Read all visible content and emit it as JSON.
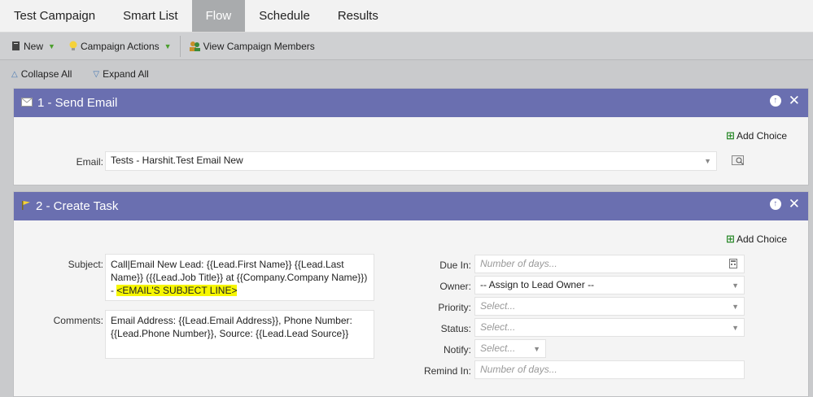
{
  "tabs": [
    "Test Campaign",
    "Smart List",
    "Flow",
    "Schedule",
    "Results"
  ],
  "toolbar": {
    "new_label": "New",
    "campaign_actions_label": "Campaign Actions",
    "view_members_label": "View Campaign Members"
  },
  "expander": {
    "collapse_label": "Collapse All",
    "expand_label": "Expand All"
  },
  "step1": {
    "title": "1 - Send Email",
    "add_choice": "Add Choice",
    "email_label": "Email:",
    "email_value": "Tests - Harshit.Test Email New"
  },
  "step2": {
    "title": "2 - Create Task",
    "add_choice": "Add Choice",
    "subject_label": "Subject:",
    "subject_text": "Call|Email New Lead: {{Lead.First Name}} {{Lead.Last Name}} ({{Lead.Job Title}} at {{Company.Company Name}}) -",
    "subject_highlight": "<EMAIL'S SUBJECT LINE>",
    "comments_label": "Comments:",
    "comments_text": "Email Address: {{Lead.Email Address}}, Phone Number: {{Lead.Phone Number}}, Source: {{Lead.Lead Source}}",
    "due_in_label": "Due In:",
    "due_in_placeholder": "Number of days...",
    "owner_label": "Owner:",
    "owner_value": "-- Assign to Lead Owner --",
    "priority_label": "Priority:",
    "priority_placeholder": "Select...",
    "status_label": "Status:",
    "status_placeholder": "Select...",
    "notify_label": "Notify:",
    "notify_placeholder": "Select...",
    "remind_in_label": "Remind In:",
    "remind_in_placeholder": "Number of days..."
  }
}
